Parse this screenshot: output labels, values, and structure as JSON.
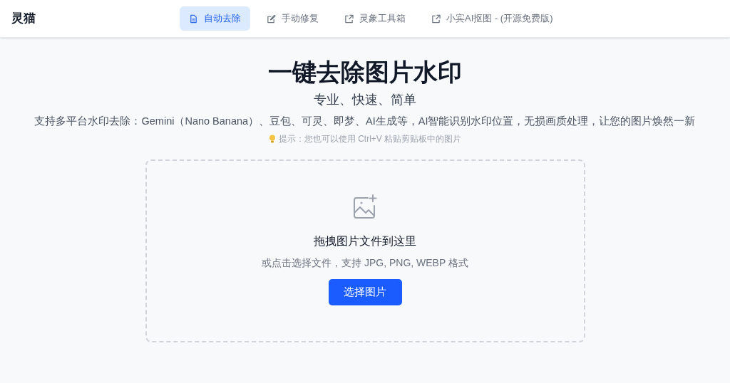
{
  "brand": "灵猫",
  "nav": [
    {
      "label": "自动去除",
      "kind": "document",
      "selected": true
    },
    {
      "label": "手动修复",
      "kind": "edit",
      "selected": false
    },
    {
      "label": "灵象工具箱",
      "kind": "external",
      "selected": false
    },
    {
      "label": "小宾AI抠图 - (开源免费版)",
      "kind": "external",
      "selected": false
    }
  ],
  "title": "一键去除图片水印",
  "subtitle": "专业、快速、简单",
  "description": "支持多平台水印去除：Gemini（Nano Banana）、豆包、可灵、即梦、AI生成等，AI智能识别水印位置，无损画质处理，让您的图片焕然一新",
  "hint": "提示：您也可以使用 Ctrl+V 粘贴剪贴板中的图片",
  "dropzone": {
    "heading": "拖拽图片文件到这里",
    "subtext": "或点击选择文件，支持 JPG, PNG, WEBP 格式",
    "button": "选择图片"
  }
}
